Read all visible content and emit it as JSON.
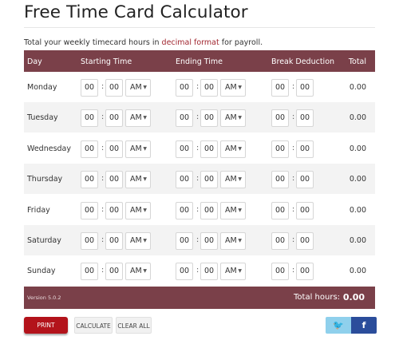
{
  "title": "Free Time Card Calculator",
  "subtitle": {
    "before": "Total your weekly timecard hours in ",
    "link": "decimal format",
    "after": " for payroll."
  },
  "table": {
    "headers": {
      "day": "Day",
      "start": "Starting Time",
      "end": "Ending Time",
      "break": "Break Deduction",
      "total": "Total"
    },
    "rows": [
      {
        "day": "Monday",
        "start_h": "00",
        "start_m": "00",
        "start_ampm": "AM",
        "end_h": "00",
        "end_m": "00",
        "end_ampm": "AM",
        "break_h": "00",
        "break_m": "00",
        "total": "0.00"
      },
      {
        "day": "Tuesday",
        "start_h": "00",
        "start_m": "00",
        "start_ampm": "AM",
        "end_h": "00",
        "end_m": "00",
        "end_ampm": "AM",
        "break_h": "00",
        "break_m": "00",
        "total": "0.00"
      },
      {
        "day": "Wednesday",
        "start_h": "00",
        "start_m": "00",
        "start_ampm": "AM",
        "end_h": "00",
        "end_m": "00",
        "end_ampm": "AM",
        "break_h": "00",
        "break_m": "00",
        "total": "0.00"
      },
      {
        "day": "Thursday",
        "start_h": "00",
        "start_m": "00",
        "start_ampm": "AM",
        "end_h": "00",
        "end_m": "00",
        "end_ampm": "AM",
        "break_h": "00",
        "break_m": "00",
        "total": "0.00"
      },
      {
        "day": "Friday",
        "start_h": "00",
        "start_m": "00",
        "start_ampm": "AM",
        "end_h": "00",
        "end_m": "00",
        "end_ampm": "AM",
        "break_h": "00",
        "break_m": "00",
        "total": "0.00"
      },
      {
        "day": "Saturday",
        "start_h": "00",
        "start_m": "00",
        "start_ampm": "AM",
        "end_h": "00",
        "end_m": "00",
        "end_ampm": "AM",
        "break_h": "00",
        "break_m": "00",
        "total": "0.00"
      },
      {
        "day": "Sunday",
        "start_h": "00",
        "start_m": "00",
        "start_ampm": "AM",
        "end_h": "00",
        "end_m": "00",
        "end_ampm": "AM",
        "break_h": "00",
        "break_m": "00",
        "total": "0.00"
      }
    ],
    "footer": {
      "version": "Version 5.0.2",
      "total_label": "Total hours:",
      "total_value": "0.00"
    }
  },
  "actions": {
    "print": "PRINT",
    "calculate": "CALCULATE",
    "clear": "CLEAR ALL",
    "twitter_icon": "twitter-icon",
    "facebook_icon": "facebook-icon",
    "twitter_glyph": "🐦",
    "facebook_glyph": "f"
  },
  "colors": {
    "header_bg": "#7a4049",
    "link": "#a1262f",
    "print_button": "#b3131b",
    "twitter": "#8fd0ec",
    "facebook": "#2b4d9b"
  }
}
